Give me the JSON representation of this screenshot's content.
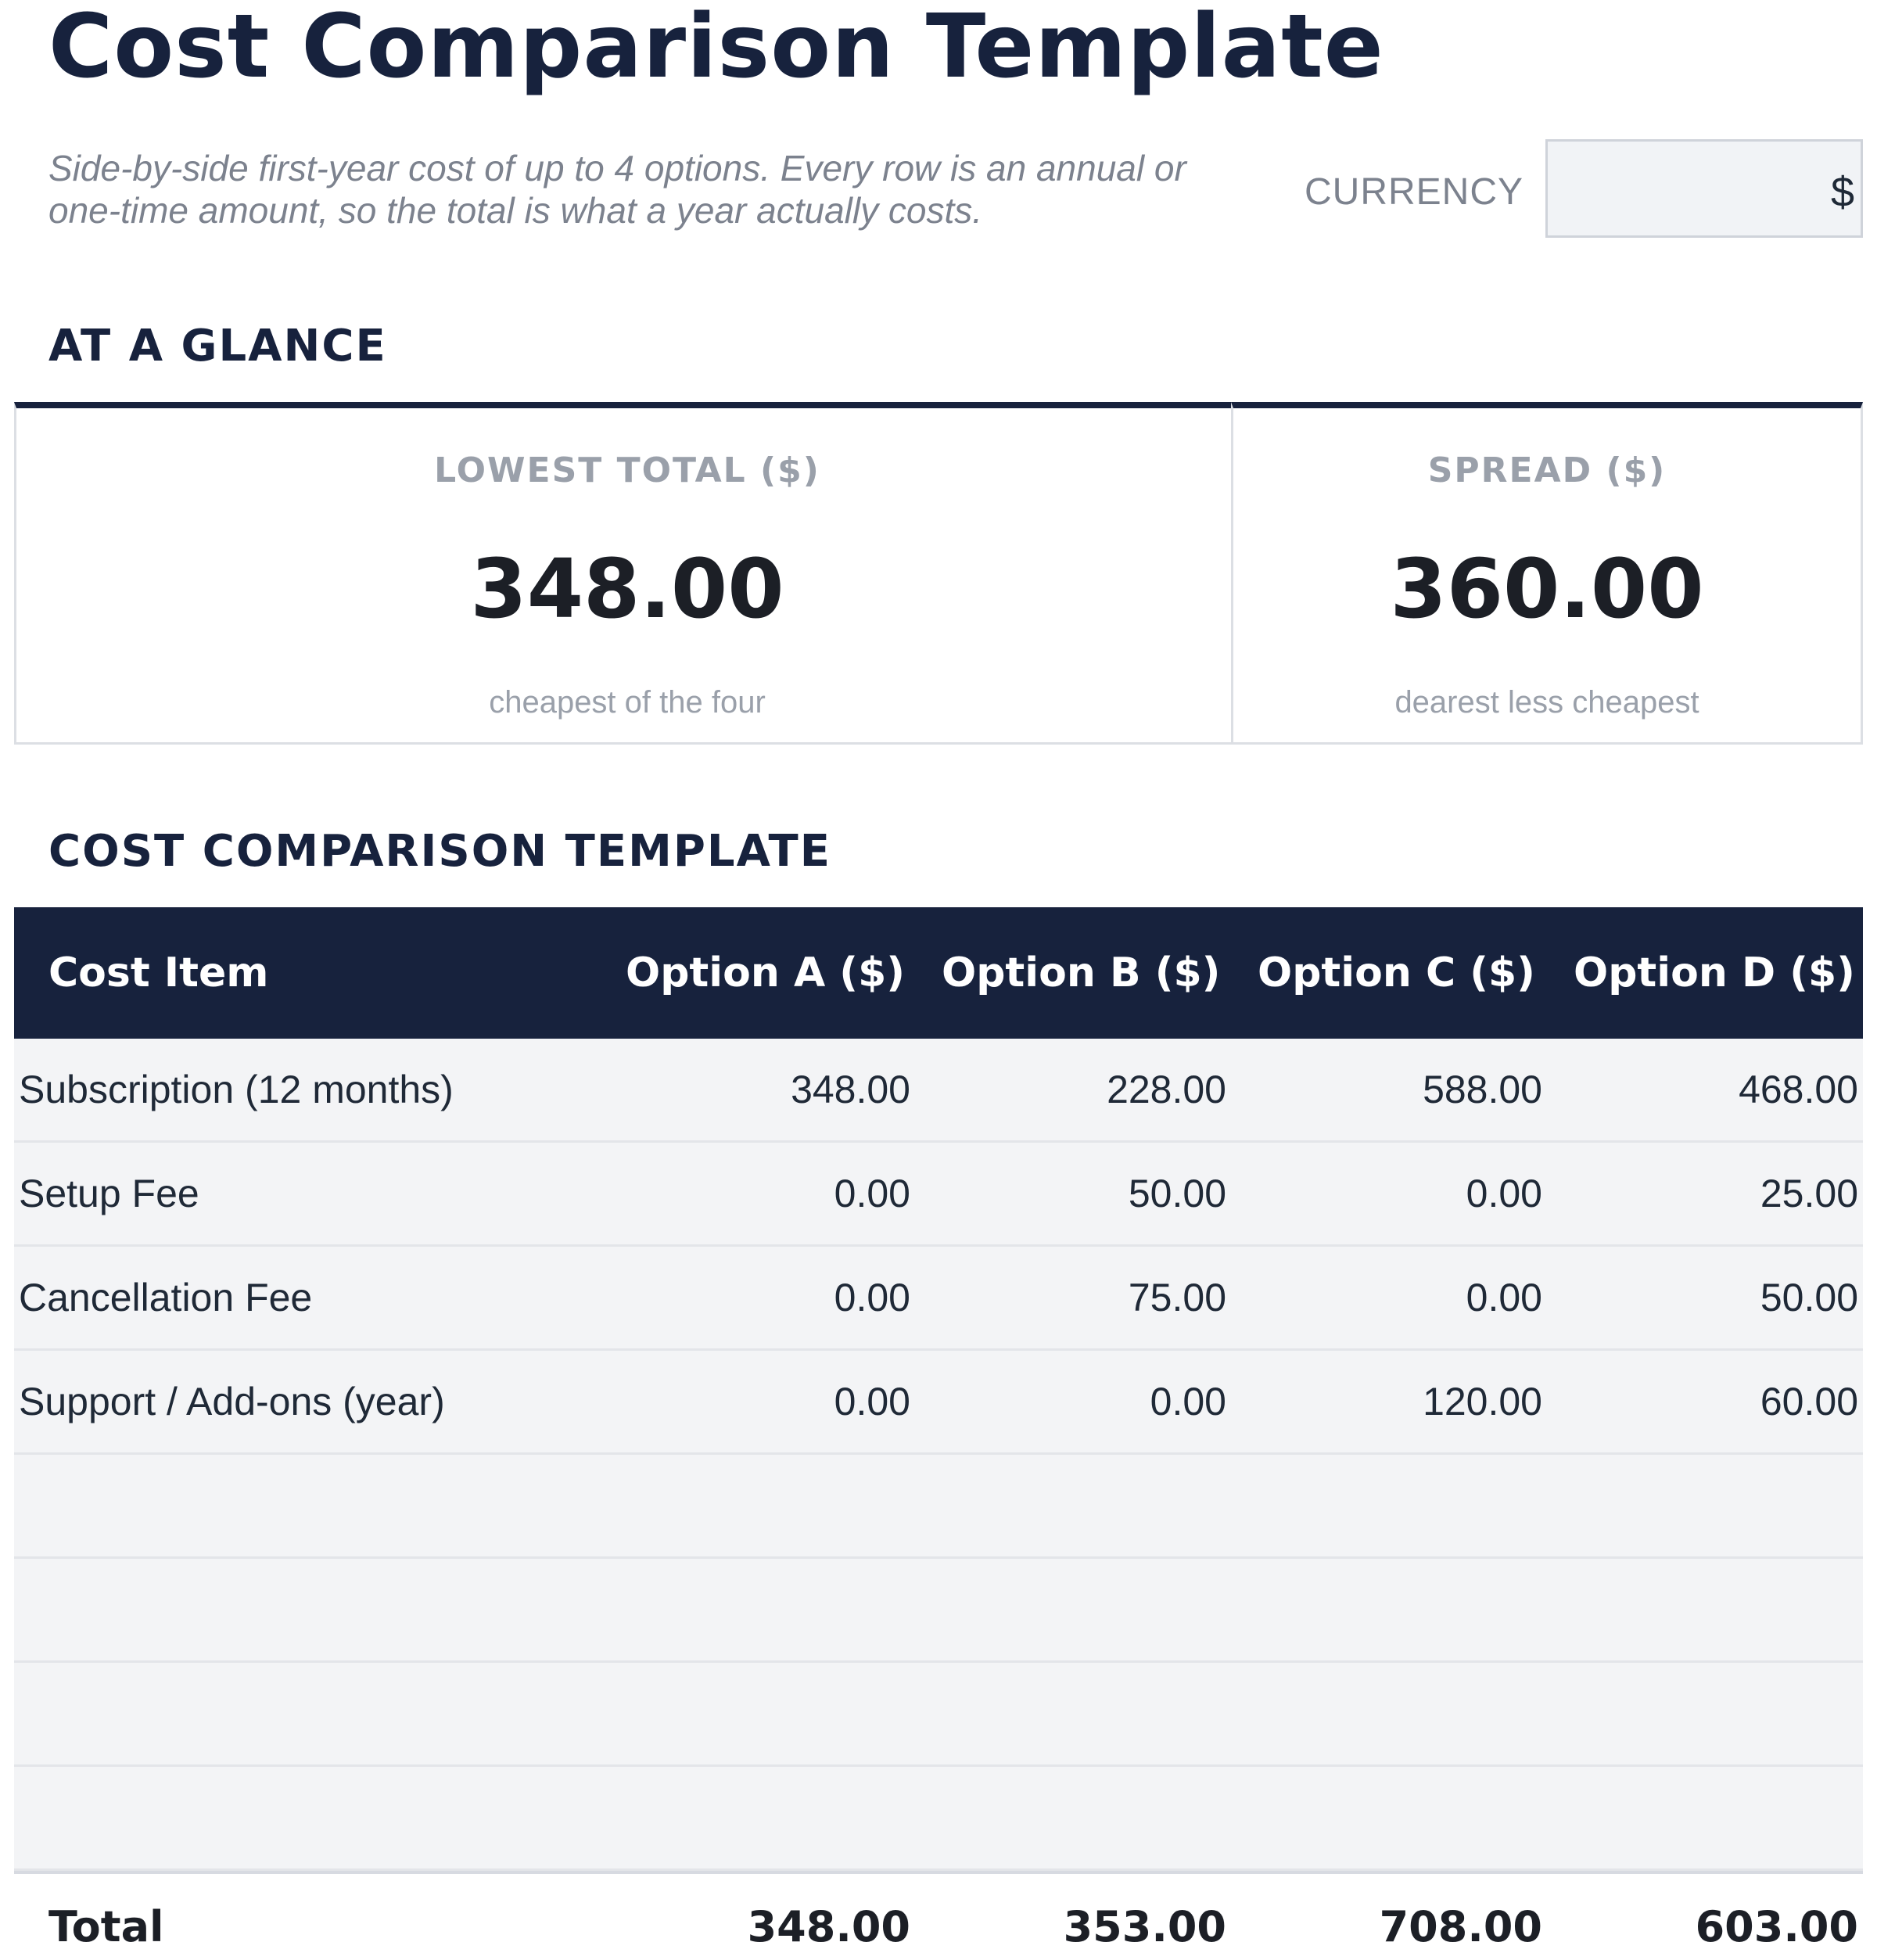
{
  "header": {
    "title": "Cost Comparison Template",
    "subtitle": "Side-by-side first-year cost of up to 4 options. Every row is an annual or one-time amount, so the total is what a year actually costs.",
    "currency_label": "CURRENCY",
    "currency_value": "$"
  },
  "glance": {
    "heading": "AT A GLANCE",
    "cards": [
      {
        "label": "LOWEST TOTAL ($)",
        "value": "348.00",
        "note": "cheapest of the four"
      },
      {
        "label": "SPREAD ($)",
        "value": "360.00",
        "note": "dearest less cheapest"
      }
    ]
  },
  "table": {
    "heading": "COST COMPARISON TEMPLATE",
    "columns": [
      "Cost Item",
      "Option A ($)",
      "Option B ($)",
      "Option C ($)",
      "Option D ($)"
    ],
    "rows": [
      [
        "Subscription (12 months)",
        "348.00",
        "228.00",
        "588.00",
        "468.00"
      ],
      [
        "Setup Fee",
        "0.00",
        "50.00",
        "0.00",
        "25.00"
      ],
      [
        "Cancellation Fee",
        "0.00",
        "75.00",
        "0.00",
        "50.00"
      ],
      [
        "Support / Add-ons (year)",
        "0.00",
        "0.00",
        "120.00",
        "60.00"
      ],
      [
        "",
        "",
        "",
        "",
        ""
      ],
      [
        "",
        "",
        "",
        "",
        ""
      ],
      [
        "",
        "",
        "",
        "",
        ""
      ],
      [
        "",
        "",
        "",
        "",
        ""
      ]
    ],
    "total": [
      "Total",
      "348.00",
      "353.00",
      "708.00",
      "603.00"
    ]
  }
}
